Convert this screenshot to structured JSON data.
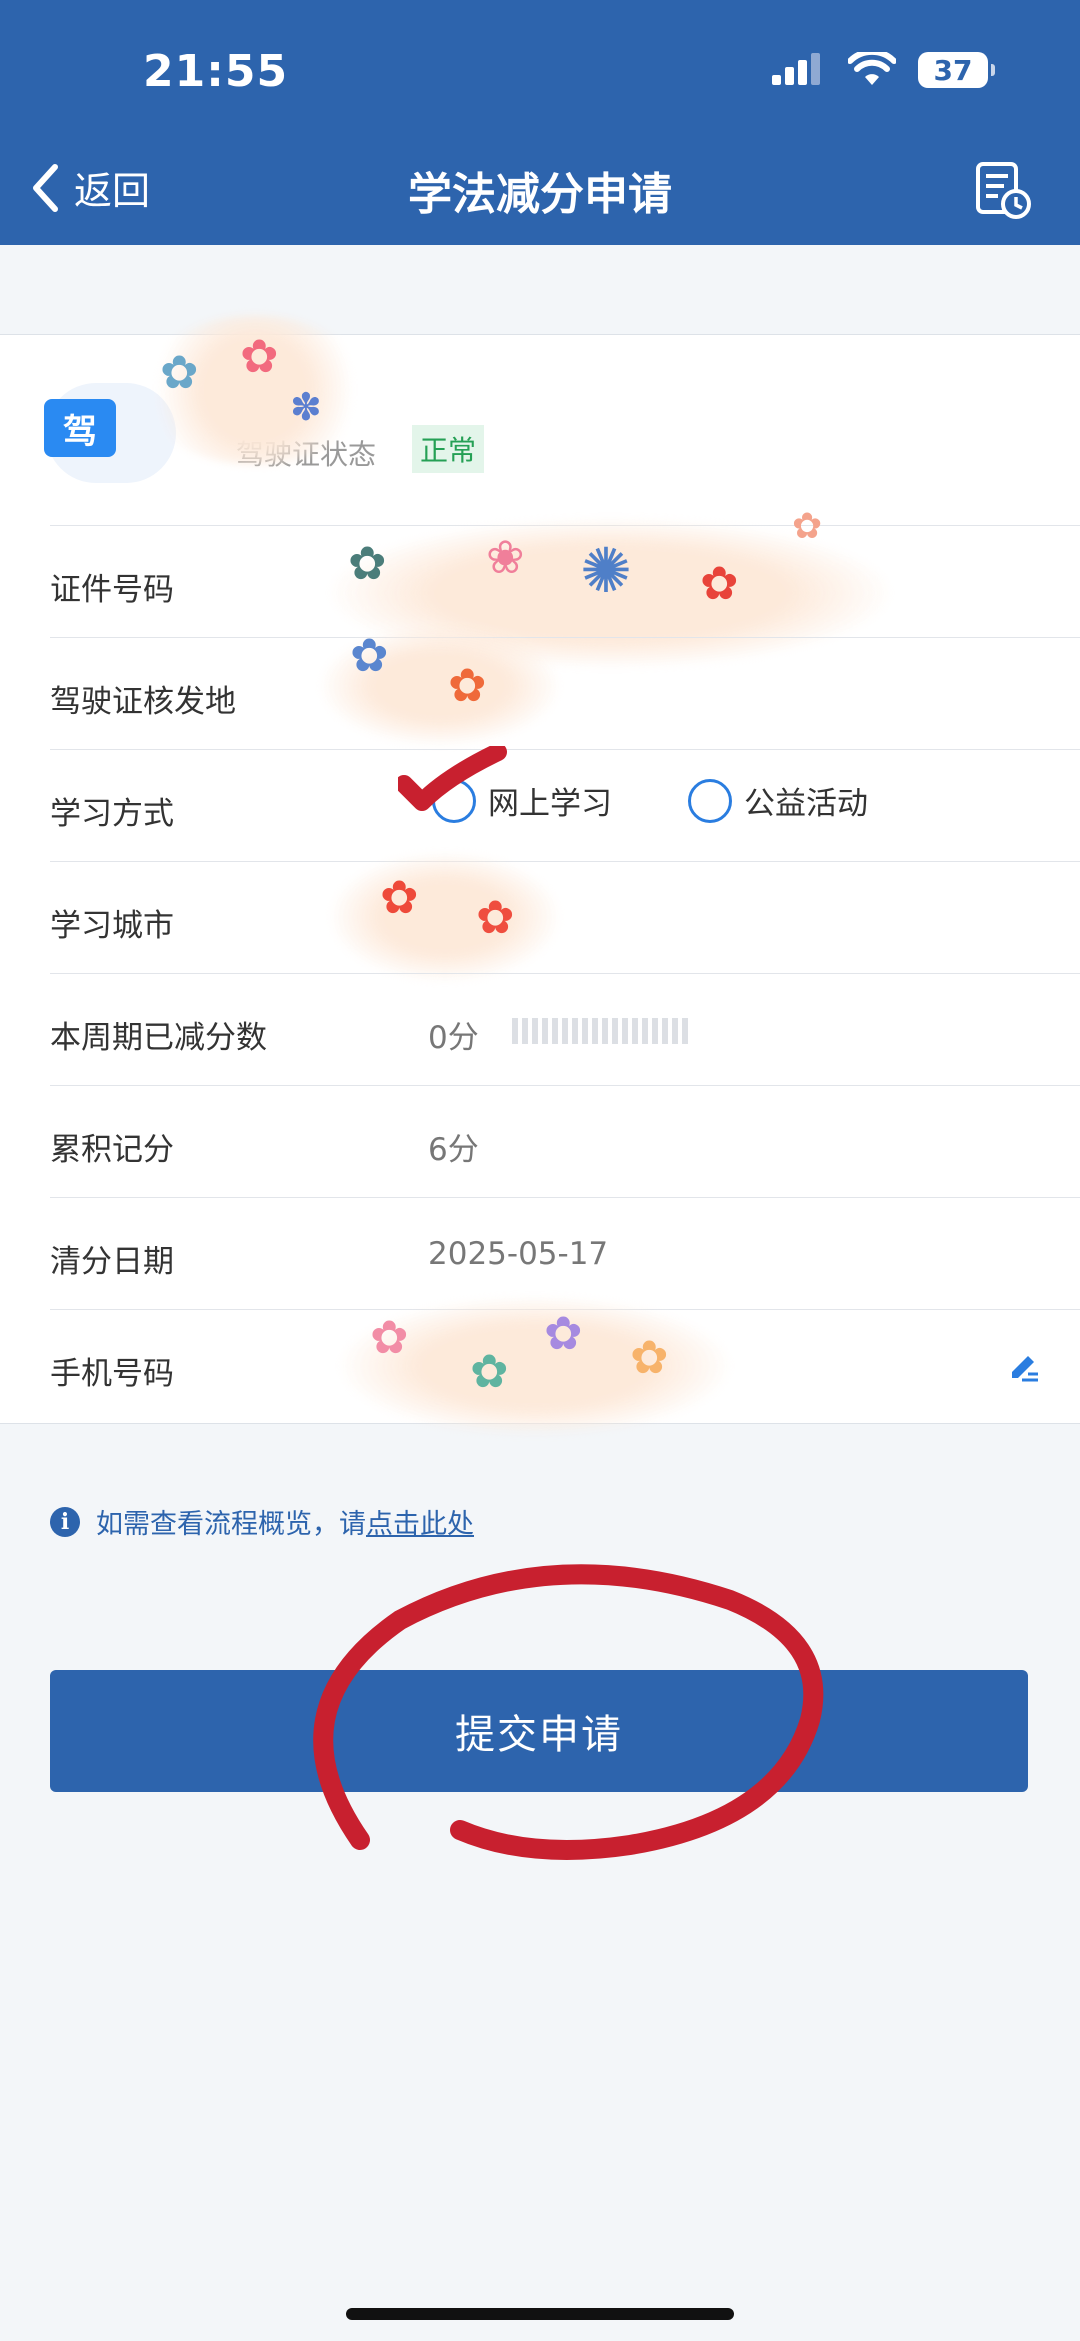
{
  "status_bar": {
    "time": "21:55",
    "battery": "37"
  },
  "nav": {
    "back_label": "返回",
    "title": "学法减分申请"
  },
  "license": {
    "icon_char": "驾",
    "status_label": "驾驶证状态",
    "status_value": "正常"
  },
  "rows": {
    "id_number": {
      "label": "证件号码"
    },
    "issue_place": {
      "label": "驾驶证核发地"
    },
    "study_method": {
      "label": "学习方式",
      "options": [
        "网上学习",
        "公益活动"
      ],
      "selected": "网上学习"
    },
    "study_city": {
      "label": "学习城市"
    },
    "deducted": {
      "label": "本周期已减分数",
      "value": "0分"
    },
    "accumulated": {
      "label": "累积记分",
      "value": "6分"
    },
    "clear_date": {
      "label": "清分日期",
      "value": "2025-05-17"
    },
    "phone": {
      "label": "手机号码"
    }
  },
  "info": {
    "prefix": "如需查看流程概览，请",
    "link": "点击此处"
  },
  "submit_label": "提交申请",
  "colors": {
    "primary": "#2d64ad",
    "accent_red": "#c8202f",
    "status_green": "#25a055"
  }
}
